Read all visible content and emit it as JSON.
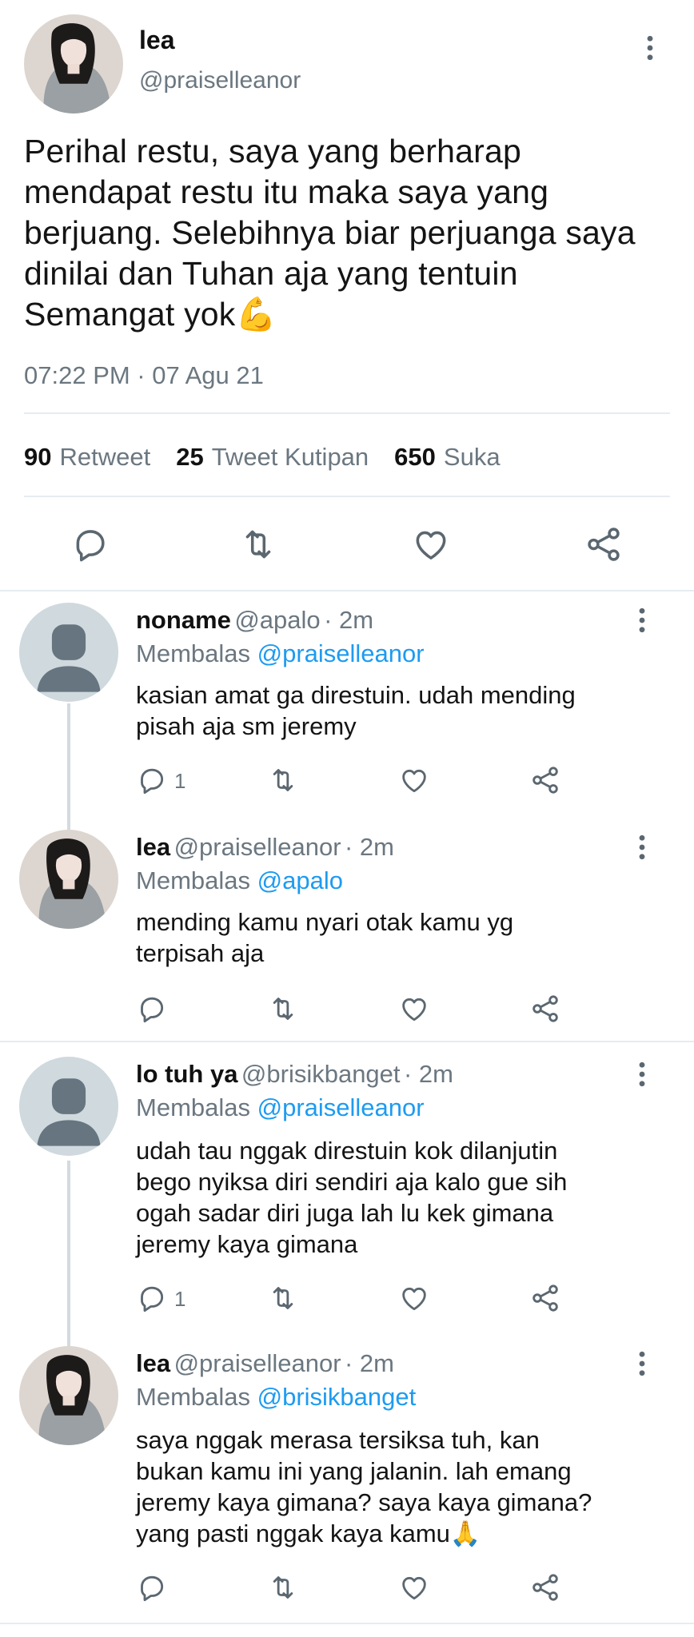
{
  "main_tweet": {
    "author_name": "lea",
    "author_handle": "@praiselleanor",
    "text_lines": [
      "Perihal restu, saya yang berharap",
      "mendapat restu itu maka saya yang",
      "berjuang. Selebihnya biar perjuanga saya",
      "dinilai dan Tuhan aja yang tentuin",
      "Semangat yok💪"
    ],
    "timestamp": "07:22 PM · 07 Agu 21",
    "stats": {
      "retweets_count": "90",
      "retweets_label": "Retweet",
      "quotes_count": "25",
      "quotes_label": "Tweet Kutipan",
      "likes_count": "650",
      "likes_label": "Suka"
    }
  },
  "icons": {
    "more": "more-vertical-icon",
    "reply": "reply-icon",
    "retweet": "retweet-icon",
    "like": "like-icon",
    "share": "share-icon"
  },
  "colors": {
    "mention": "#1d9bf0",
    "muted": "#6b7780",
    "divider": "#e6ecf0",
    "thread_line": "#d3dbe1"
  },
  "replies": [
    {
      "name": "noname",
      "handle": "@apalo",
      "time": "· 2m",
      "replying_prefix": "Membalas",
      "replying_to": "@praiselleanor",
      "text_lines": [
        "kasian amat ga direstuin. udah mending",
        "pisah aja sm jeremy"
      ],
      "reply_count": "1"
    },
    {
      "name": "lea",
      "handle": "@praiselleanor",
      "time": "· 2m",
      "replying_prefix": "Membalas",
      "replying_to": "@apalo",
      "text_lines": [
        "mending kamu nyari otak kamu yg",
        "terpisah aja"
      ],
      "reply_count": ""
    },
    {
      "name": "lo tuh ya",
      "handle": "@brisikbanget",
      "time": "· 2m",
      "replying_prefix": "Membalas",
      "replying_to": "@praiselleanor",
      "text_lines": [
        "udah tau nggak direstuin kok dilanjutin",
        "bego nyiksa diri sendiri aja kalo gue sih",
        "ogah sadar diri juga lah lu kek gimana",
        "jeremy kaya gimana"
      ],
      "reply_count": "1"
    },
    {
      "name": "lea",
      "handle": "@praiselleanor",
      "time": "· 2m",
      "replying_prefix": "Membalas",
      "replying_to": "@brisikbanget",
      "text_lines": [
        "saya nggak merasa tersiksa tuh, kan",
        "bukan kamu ini yang jalanin. lah emang",
        "jeremy kaya gimana? saya kaya gimana?",
        "yang pasti nggak kaya kamu🙏"
      ],
      "reply_count": ""
    }
  ]
}
